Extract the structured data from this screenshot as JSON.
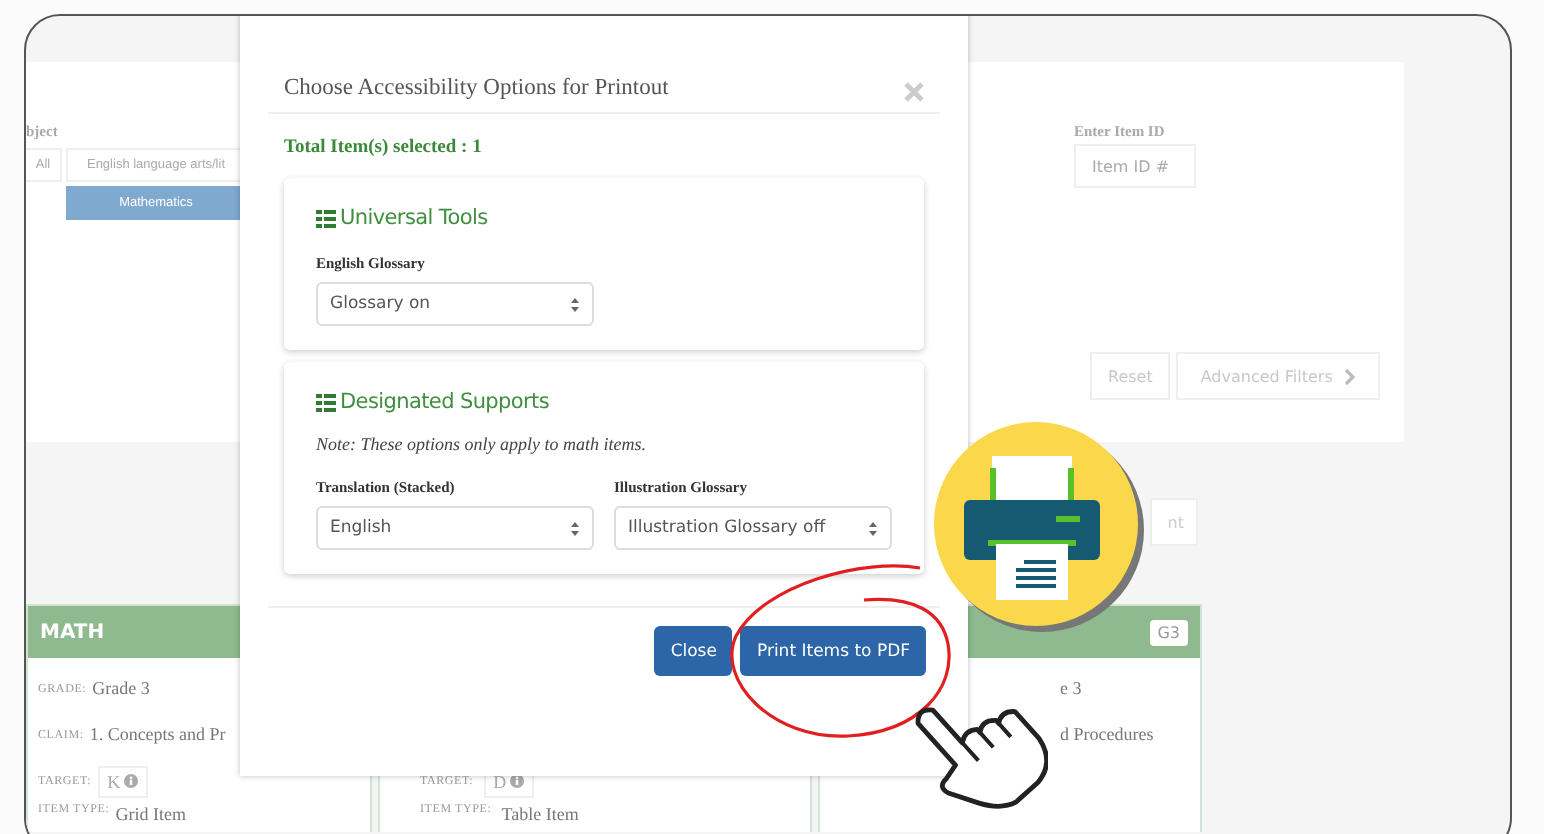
{
  "filters": {
    "subject_label": "bject",
    "subjects": [
      {
        "label": "All",
        "selected": false
      },
      {
        "label": "English language arts/lit",
        "selected": false
      },
      {
        "label": "Mathematics",
        "selected": true
      }
    ],
    "item_id": {
      "label": "Enter Item ID",
      "placeholder": "Item ID #"
    },
    "actions": [
      {
        "label": "Reset",
        "kind": "plain"
      },
      {
        "label": "Advanced Filters",
        "kind": "chevron"
      }
    ]
  },
  "cut_button": "nt",
  "cards": [
    {
      "subject": "MATH",
      "fields": [
        {
          "label": "GRADE:",
          "value": "Grade 3",
          "kind": "text"
        },
        {
          "label": "CLAIM:",
          "value": "1. Concepts and Pr",
          "kind": "text"
        },
        {
          "label": "TARGET:",
          "value": "K",
          "kind": "target"
        },
        {
          "label": "ITEM TYPE:",
          "value": "Grid Item",
          "kind": "text"
        }
      ]
    },
    {
      "fields": [
        {
          "label": "TARGET:",
          "value": "D",
          "kind": "target"
        },
        {
          "label": "ITEM TYPE:",
          "value": "Table Item",
          "kind": "text"
        }
      ]
    },
    {
      "badge": "G3",
      "fields": [
        {
          "value": "e 3",
          "kind": "text"
        },
        {
          "value": "d Procedures",
          "kind": "text"
        }
      ]
    }
  ],
  "dialog": {
    "title": "Choose Accessibility Options for Printout",
    "summary": "Total Item(s) selected : 1",
    "sections": [
      {
        "title": "Universal Tools",
        "selects": [
          {
            "label": "English Glossary",
            "value": "Glossary on"
          }
        ]
      },
      {
        "title": "Designated Supports",
        "note": "Note: These options only apply to math items.",
        "selects": [
          {
            "label": "Translation (Stacked)",
            "value": "English"
          },
          {
            "label": "Illustration Glossary",
            "value": "Illustration Glossary off"
          }
        ]
      }
    ],
    "buttons": [
      {
        "label": "Close",
        "circled": false
      },
      {
        "label": "Print Items to PDF",
        "circled": true
      }
    ]
  }
}
